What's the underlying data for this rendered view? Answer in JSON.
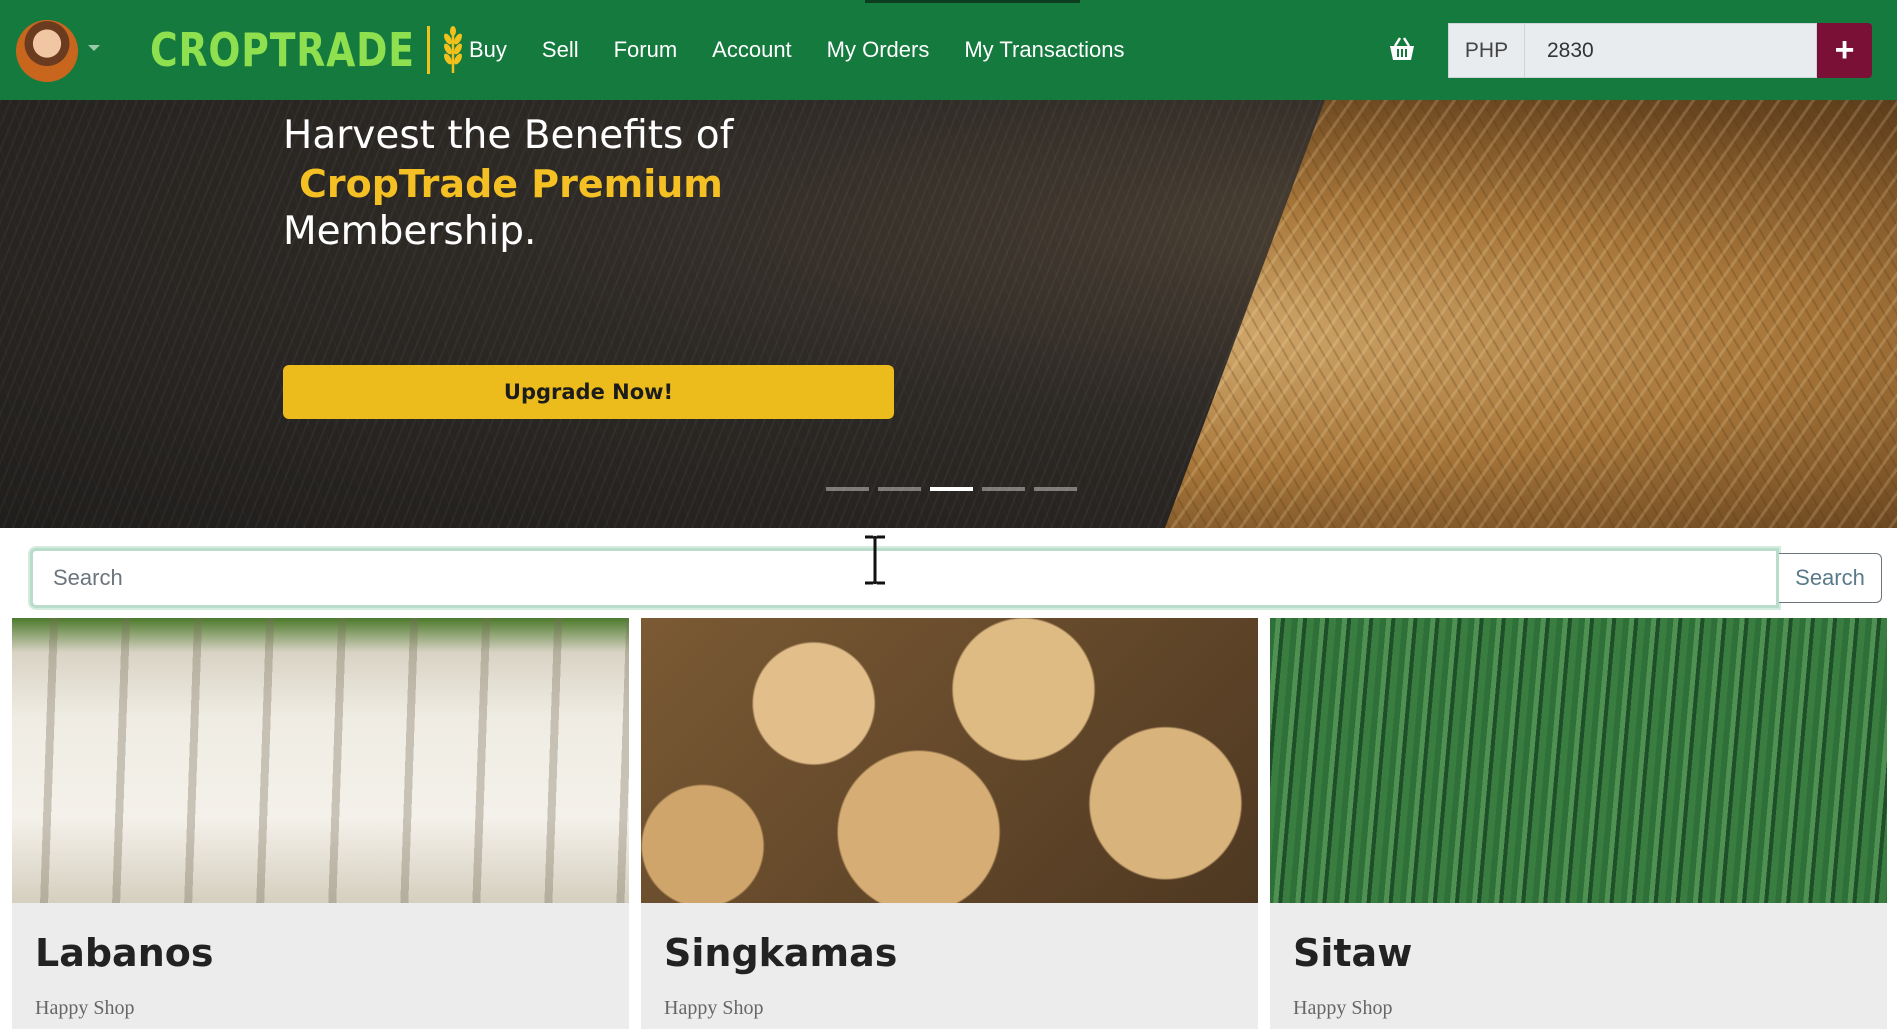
{
  "nav": {
    "links": [
      "Buy",
      "Sell",
      "Forum",
      "Account",
      "My Orders",
      "My Transactions"
    ],
    "brand": "CROPTRADE",
    "brand_color": "#8fe04f",
    "bar_color": "#157a3e"
  },
  "balance": {
    "currency": "PHP",
    "amount": "2830",
    "add_icon": "plus-icon"
  },
  "hero": {
    "line1": "Harvest the Benefits of",
    "highlight": "CropTrade Premium",
    "line3": "Membership.",
    "button": "Upgrade Now!",
    "slides_count": 5,
    "active_slide": 3,
    "accent": "#ebbc1b"
  },
  "search": {
    "placeholder": "Search",
    "button": "Search"
  },
  "products": [
    {
      "name": "Labanos",
      "shop": "Happy Shop"
    },
    {
      "name": "Singkamas",
      "shop": "Happy Shop"
    },
    {
      "name": "Sitaw",
      "shop": "Happy Shop"
    }
  ]
}
